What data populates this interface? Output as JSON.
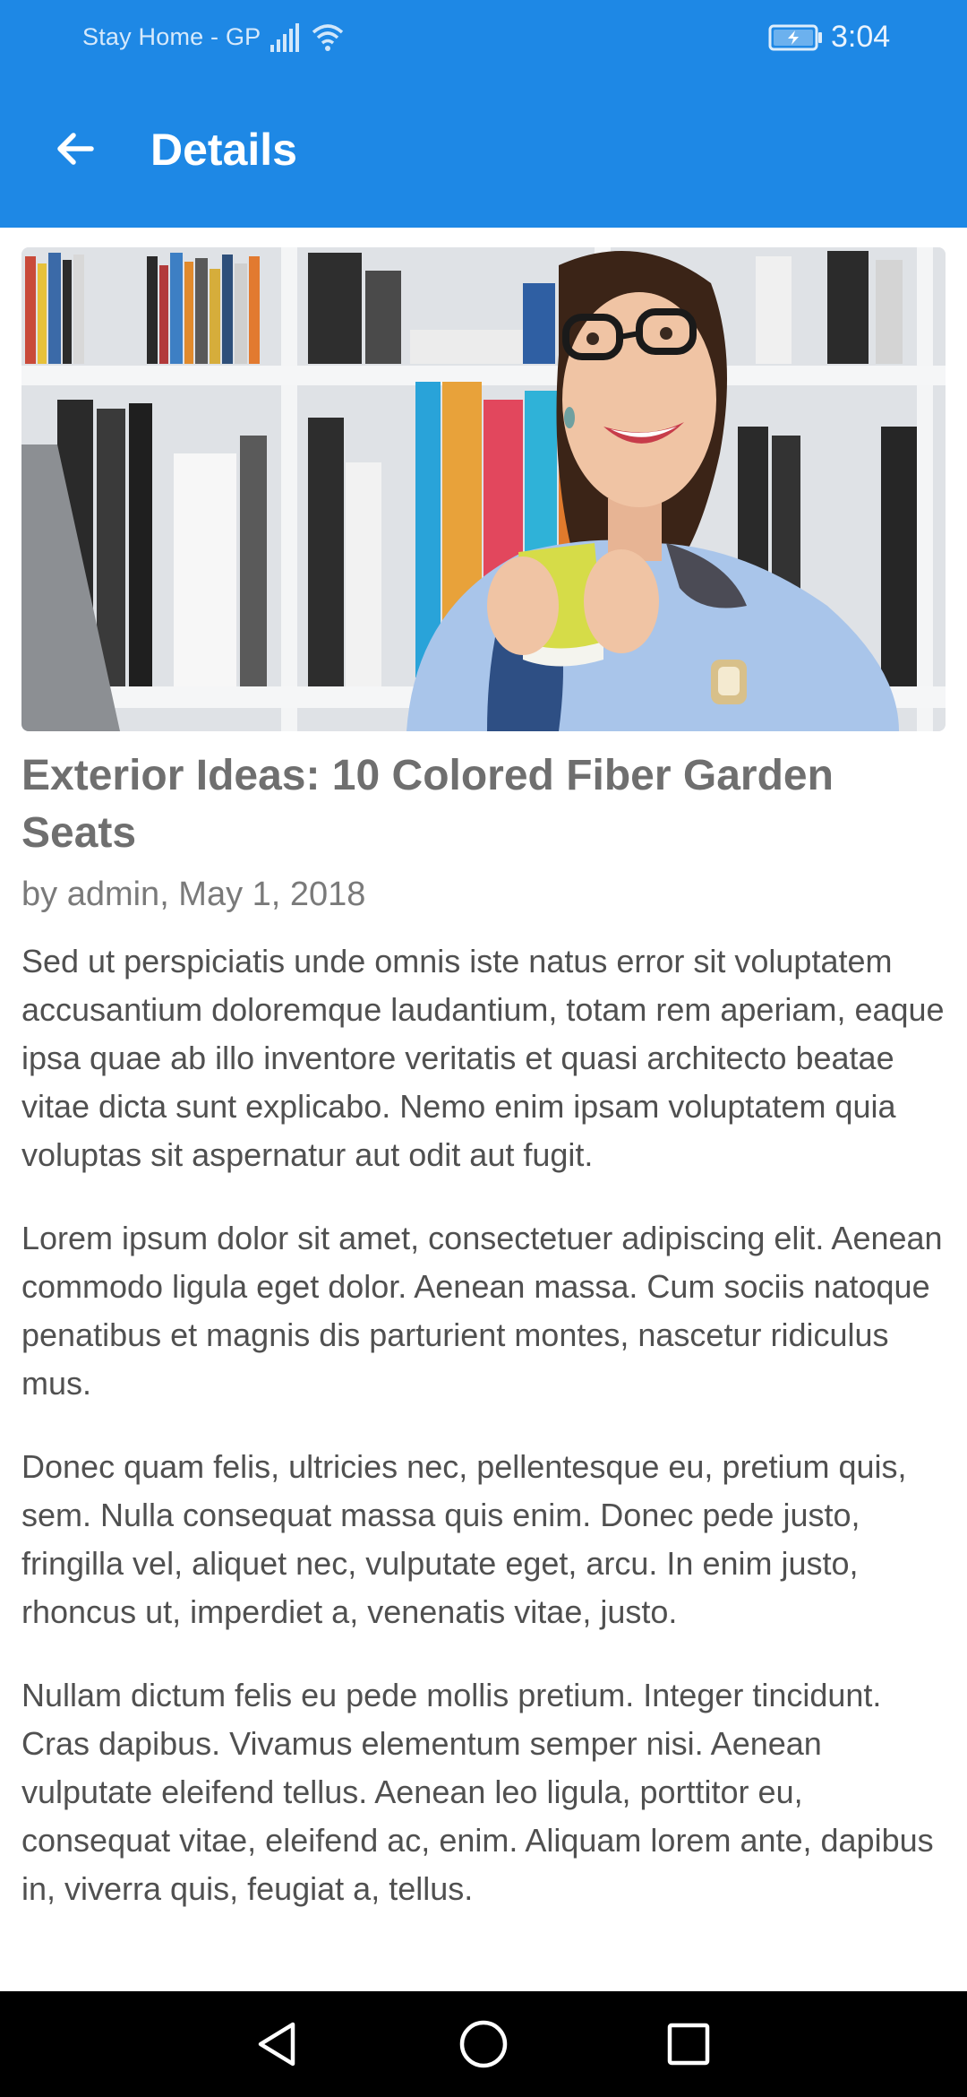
{
  "status_bar": {
    "carrier": "Stay Home - GP",
    "time": "3:04",
    "icons": [
      "signal-icon",
      "wifi-icon",
      "battery-charging-icon"
    ]
  },
  "app_bar": {
    "title": "Details",
    "back_icon": "arrow-back-icon",
    "color": "#1E88E5"
  },
  "article": {
    "image_icon": "photo-woman-with-mug-bookshelf",
    "title": "Exterior Ideas: 10 Colored Fiber Garden Seats",
    "byline": "by admin, May 1, 2018",
    "paragraphs": [
      "Sed ut perspiciatis unde omnis iste natus error sit voluptatem accusantium doloremque laudantium, totam rem aperiam, eaque ipsa quae ab illo inventore veritatis et quasi architecto beatae vitae dicta sunt explicabo. Nemo enim ipsam voluptatem quia voluptas sit aspernatur aut odit aut fugit.",
      "Lorem ipsum dolor sit amet, consectetuer adipiscing elit. Aenean commodo ligula eget dolor. Aenean massa. Cum sociis natoque penatibus et magnis dis parturient montes, nascetur ridiculus mus.",
      "Donec quam felis, ultricies nec, pellentesque eu, pretium quis, sem. Nulla consequat massa quis enim. Donec pede justo, fringilla vel, aliquet nec, vulputate eget, arcu. In enim justo, rhoncus ut, imperdiet a, venenatis vitae, justo.",
      "Nullam dictum felis eu pede mollis pretium. Integer tincidunt. Cras dapibus. Vivamus elementum semper nisi. Aenean vulputate eleifend tellus. Aenean leo ligula, porttitor eu, consequat vitae, eleifend ac, enim. Aliquam lorem ante, dapibus in, viverra quis, feugiat a, tellus."
    ]
  },
  "nav_bar": {
    "icons": [
      "nav-back-icon",
      "nav-home-icon",
      "nav-recents-icon"
    ]
  }
}
